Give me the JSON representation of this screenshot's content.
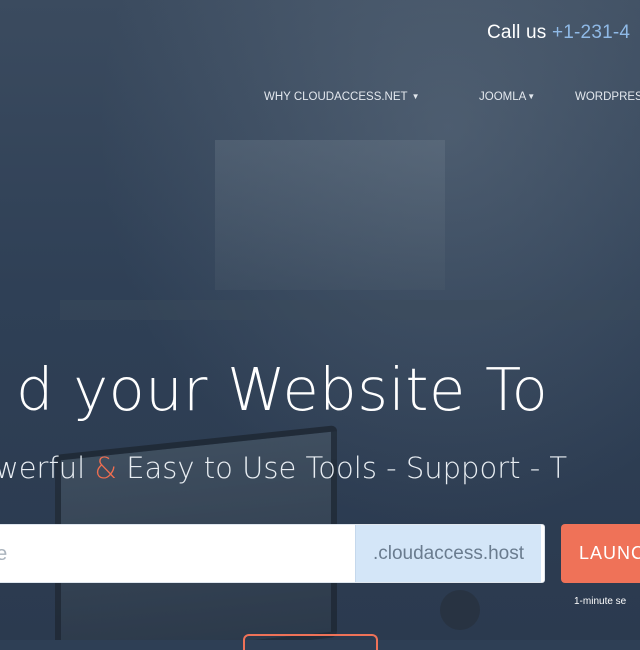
{
  "topbar": {
    "call_label": "Call us",
    "phone": "+1-231-4"
  },
  "nav": {
    "items": [
      {
        "label": "WHY CLOUDACCESS.NET",
        "has_caret": true
      },
      {
        "label": "JOOMLA",
        "has_caret": true
      },
      {
        "label": "WORDPRES",
        "has_caret": false
      }
    ]
  },
  "hero": {
    "headline": "d your Website To",
    "subline_start": "werful",
    "subline_amp": "&",
    "subline_end": "Easy to Use Tools - Support - T"
  },
  "domain_form": {
    "input_placeholder": "ne",
    "suffix": ".cloudaccess.host",
    "launch_label": "LAUNC",
    "launch_note": "1-minute se"
  },
  "colors": {
    "accent": "#ef7258",
    "phone": "#8fb9e6",
    "suffix_bg": "#d4e6f8"
  },
  "icons": {
    "caret": "caret-down-icon"
  }
}
